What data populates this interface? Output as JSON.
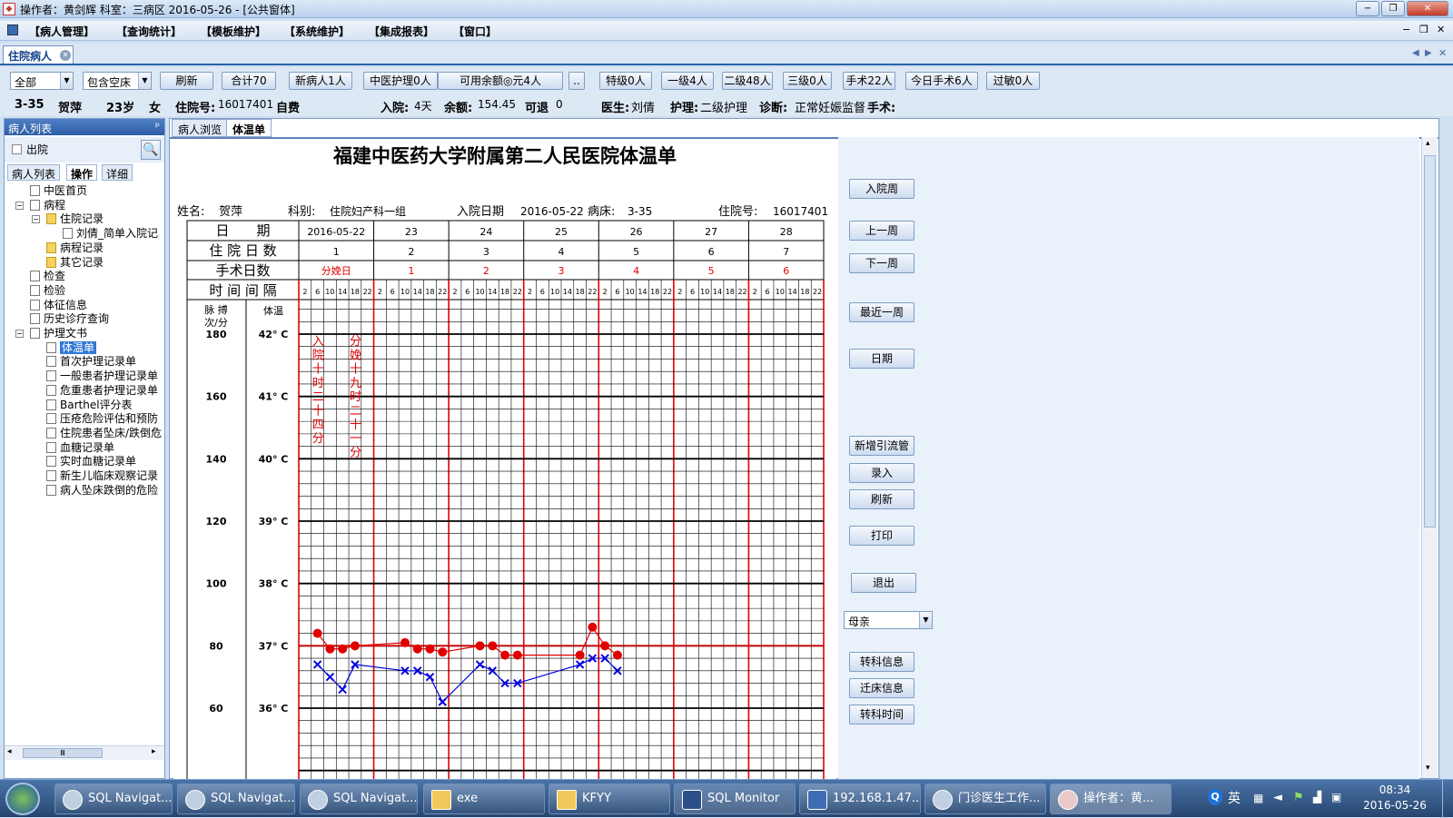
{
  "window": {
    "title": "操作者：黄剑辉  科室：三病区  2016-05-26 - [公共窗体]"
  },
  "menu": [
    "【病人管理】",
    "【查询统计】",
    "【模板维护】",
    "【系统维护】",
    "【集成报表】",
    "【窗口】"
  ],
  "main_tab": {
    "label": "住院病人"
  },
  "toolbar": {
    "filter_value": "全部",
    "bed_filter_value": "包含空床",
    "buttons": [
      "刷新",
      "合计70",
      "新病人1人",
      "中医护理0人",
      "可用余额◎元4人",
      "..",
      "特级0人",
      "一级4人",
      "二级48人",
      "三级0人",
      "手术22人",
      "今日手术6人",
      "过敏0人"
    ]
  },
  "patient_info": {
    "bed": "3-35",
    "name": "贺萍",
    "age": "23岁",
    "sex": "女",
    "admission_no_label": "住院号:",
    "admission_no": "16017401",
    "pay_type": "自费",
    "stay_label": "入院:",
    "stay": "4天",
    "balance_label": "余额:",
    "balance": "154.45",
    "withdraw_label": "可退",
    "withdraw": "0",
    "doctor_label": "医生:",
    "doctor": "刘倩",
    "nursing_label": "护理:",
    "nursing": "二级护理",
    "diagnosis_label": "诊断:",
    "diagnosis": "正常妊娠监督",
    "surgery_label": "手术:"
  },
  "left_pane": {
    "header": "病人列表",
    "pin": "ᵖ",
    "search_option": "出院",
    "tabs": [
      "病人列表",
      "操作",
      "详细"
    ],
    "tree": [
      {
        "label": "中医首页",
        "level": 1
      },
      {
        "label": "病程",
        "level": 1,
        "expander": "−"
      },
      {
        "label": "住院记录",
        "level": 2,
        "expander": "−",
        "folder": true
      },
      {
        "label": "刘倩_简单入院记",
        "level": 3
      },
      {
        "label": "病程记录",
        "level": 2,
        "folder": true
      },
      {
        "label": "其它记录",
        "level": 2,
        "folder": true
      },
      {
        "label": "检查",
        "level": 1
      },
      {
        "label": "检验",
        "level": 1
      },
      {
        "label": "体征信息",
        "level": 1
      },
      {
        "label": "历史诊疗查询",
        "level": 1
      },
      {
        "label": "护理文书",
        "level": 1,
        "expander": "−"
      },
      {
        "label": "体温单",
        "level": 2,
        "selected": true
      },
      {
        "label": "首次护理记录单",
        "level": 2
      },
      {
        "label": "一般患者护理记录单",
        "level": 2
      },
      {
        "label": "危重患者护理记录单",
        "level": 2
      },
      {
        "label": "Barthel评分表",
        "level": 2
      },
      {
        "label": "压疮危险评估和预防",
        "level": 2
      },
      {
        "label": "住院患者坠床/跌倒危",
        "level": 2
      },
      {
        "label": "血糖记录单",
        "level": 2
      },
      {
        "label": "实时血糖记录单",
        "level": 2
      },
      {
        "label": "新生儿临床观察记录",
        "level": 2
      },
      {
        "label": "病人坠床跌倒的危险",
        "level": 2
      }
    ],
    "hscroll_label": "Ⅲ"
  },
  "center_tabs": [
    "病人浏览",
    "体温单"
  ],
  "chart_sheet": {
    "hospital_title": "福建中医药大学附属第二人民医院体温单",
    "name_label": "姓名:",
    "name": "贺萍",
    "dept_label": "科别:",
    "dept": "住院妇产科一组",
    "admit_date_label": "入院日期",
    "admit_date": "2016-05-22",
    "bed_label": "病床:",
    "bed": "3-35",
    "adm_no_label": "住院号:",
    "adm_no": "16017401",
    "row_date_label": "日　　期",
    "row_days_label": "住 院 日 数",
    "row_surgery_label": "手术日数",
    "row_interval_label": "时 间 间 隔",
    "pulse_label_1": "脉 搏",
    "pulse_label_2": "次/分",
    "temp_label": "体温",
    "note_1": "入院十时二十四分",
    "note_2": "分娩十九时二十一分"
  },
  "chart_data": {
    "type": "line",
    "dates": [
      "2016-05-22",
      "23",
      "24",
      "25",
      "26",
      "27",
      "28"
    ],
    "hospital_days": [
      "1",
      "2",
      "3",
      "4",
      "5",
      "6",
      "7"
    ],
    "surgery_days": [
      "分娩日",
      "1",
      "2",
      "3",
      "4",
      "5",
      "6"
    ],
    "time_slots": [
      "2",
      "6",
      "10",
      "14",
      "18",
      "22"
    ],
    "pulse_ticks": [
      "180",
      "160",
      "140",
      "120",
      "100",
      "80",
      "60"
    ],
    "temp_ticks": [
      "42° C",
      "41° C",
      "40° C",
      "39° C",
      "38° C",
      "37° C",
      "36° C"
    ],
    "series": [
      {
        "marker": "dot",
        "color": "#e00000",
        "points": [
          [
            1,
            84
          ],
          [
            2,
            79
          ],
          [
            3,
            79
          ],
          [
            4,
            80
          ],
          [
            8,
            81
          ],
          [
            9,
            79
          ],
          [
            10,
            79
          ],
          [
            11,
            78
          ],
          [
            14,
            80
          ],
          [
            15,
            80
          ],
          [
            16,
            77
          ],
          [
            17,
            77
          ],
          [
            22,
            77
          ],
          [
            23,
            86
          ],
          [
            24,
            80
          ],
          [
            25,
            77
          ]
        ]
      },
      {
        "marker": "x",
        "color": "#0000dd",
        "points": [
          [
            1,
            36.7
          ],
          [
            2,
            36.5
          ],
          [
            3,
            36.3
          ],
          [
            4,
            36.7
          ],
          [
            8,
            36.6
          ],
          [
            9,
            36.6
          ],
          [
            10,
            36.5
          ],
          [
            11,
            36.1
          ],
          [
            14,
            36.7
          ],
          [
            15,
            36.6
          ],
          [
            16,
            36.4
          ],
          [
            17,
            36.4
          ],
          [
            22,
            36.7
          ],
          [
            23,
            36.8
          ],
          [
            24,
            36.8
          ],
          [
            25,
            36.6
          ]
        ]
      }
    ]
  },
  "right_panel": {
    "buttons": [
      "入院周",
      "上一周",
      "下一周",
      "最近一周",
      "日期",
      "新增引流管",
      "录入",
      "刷新",
      "打印",
      "退出"
    ],
    "mother_select": "母亲",
    "bottom_buttons": [
      "转科信息",
      "迁床信息",
      "转科时间"
    ]
  },
  "taskbar": {
    "items": [
      "SQL Navigat...",
      "SQL Navigat...",
      "SQL Navigat...",
      "exe",
      "KFYY",
      "SQL Monitor",
      "192.168.1.47...",
      "门诊医生工作...",
      "操作者：黄..."
    ],
    "tray": {
      "ime": "英",
      "time": "08:34",
      "date": "2016-05-26"
    }
  }
}
